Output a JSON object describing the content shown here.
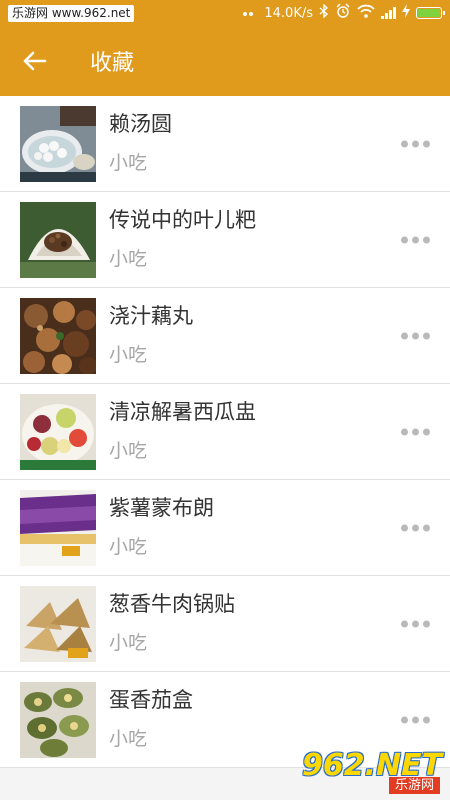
{
  "status_bar": {
    "watermark": "乐游网 www.962.net",
    "network_speed": "14.0K/s",
    "battery_level": 1.0,
    "battery_color": "#7ed23d"
  },
  "app_bar": {
    "back_icon": "arrow-left-icon",
    "title": "收藏",
    "background_color": "#e09a1c"
  },
  "favorites": [
    {
      "title": "赖汤圆",
      "category": "小吃",
      "thumb": "tangyuan"
    },
    {
      "title": "传说中的叶儿粑",
      "category": "小吃",
      "thumb": "yeerba"
    },
    {
      "title": "浇汁藕丸",
      "category": "小吃",
      "thumb": "ouwan"
    },
    {
      "title": "清凉解暑西瓜盅",
      "category": "小吃",
      "thumb": "xigua"
    },
    {
      "title": "紫薯蒙布朗",
      "category": "小吃",
      "thumb": "zishu"
    },
    {
      "title": "葱香牛肉锅贴",
      "category": "小吃",
      "thumb": "guotie"
    },
    {
      "title": "蛋香茄盒",
      "category": "小吃",
      "thumb": "qiehe"
    }
  ],
  "logo": {
    "big": "962.NET",
    "small": "乐游网"
  }
}
